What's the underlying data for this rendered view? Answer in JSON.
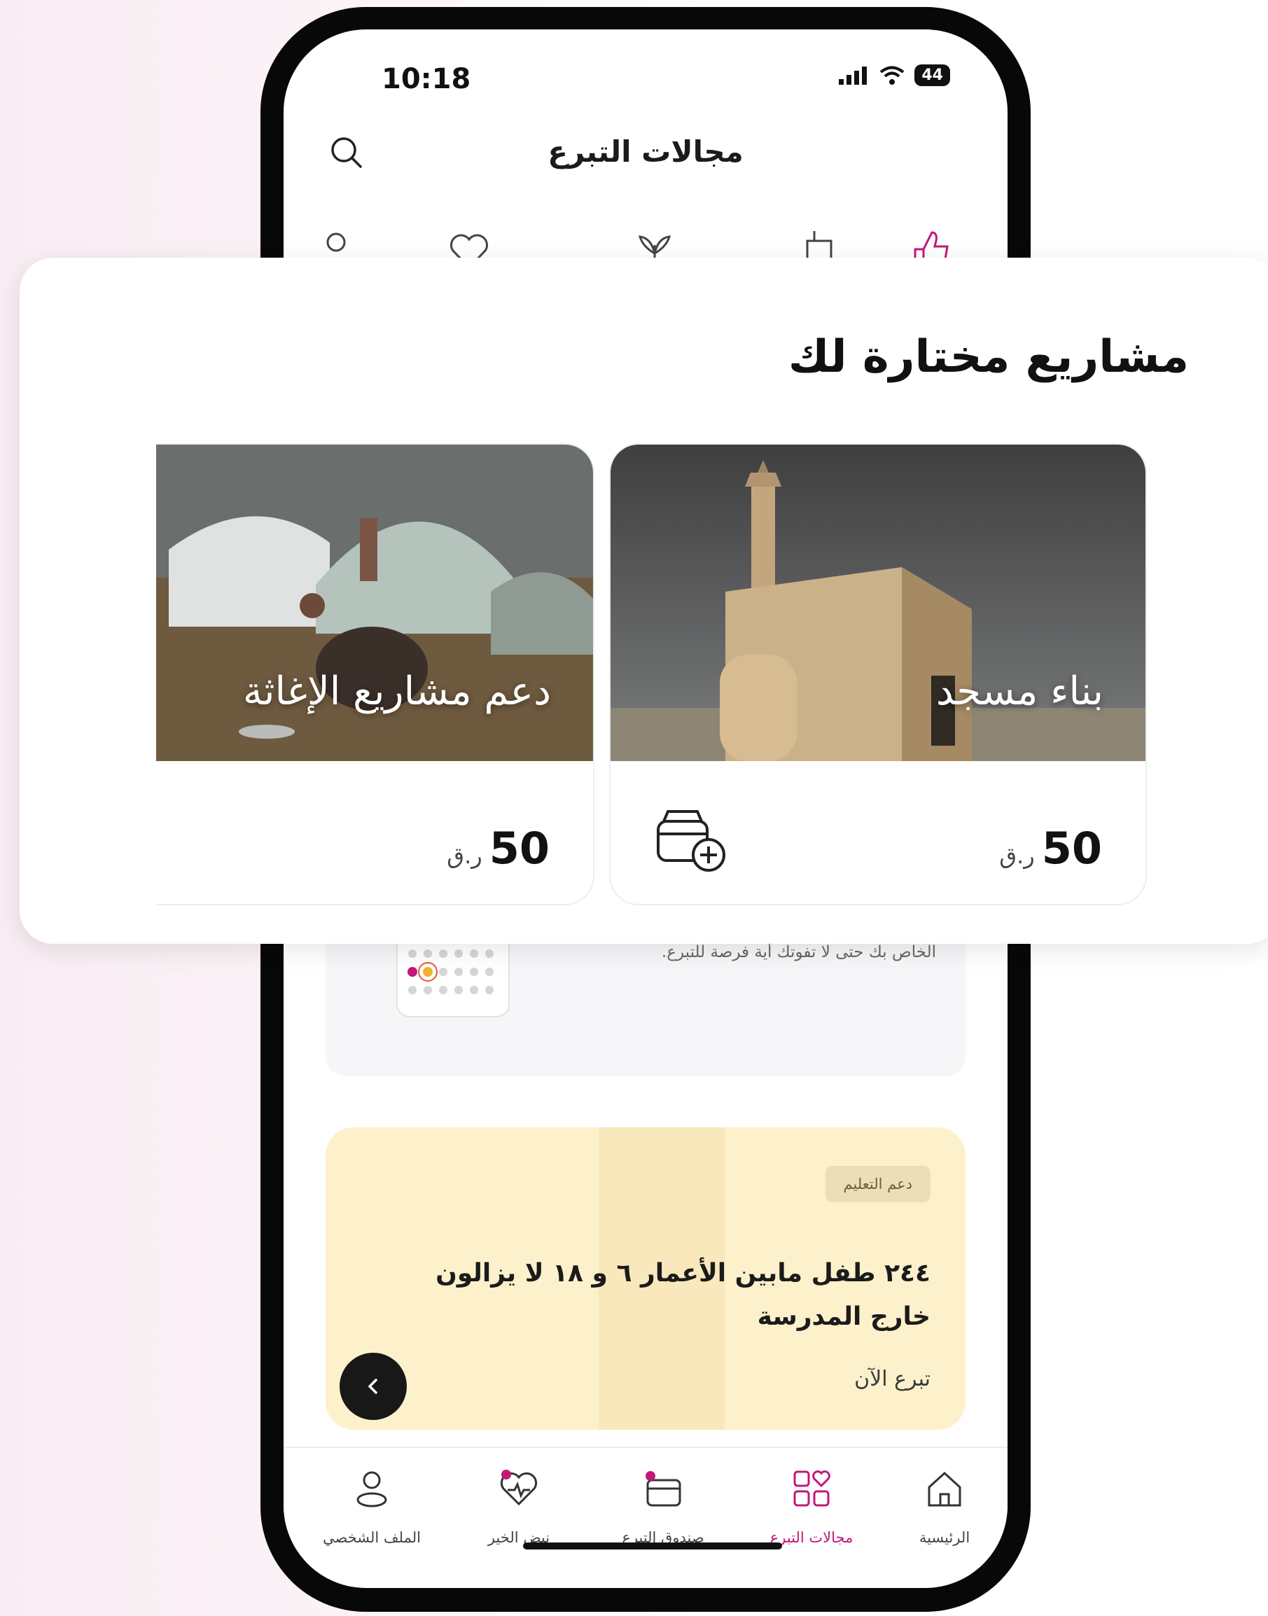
{
  "status": {
    "time": "10:18",
    "battery": "44"
  },
  "header": {
    "title": "مجالات التبرع"
  },
  "featured": {
    "title": "مشاريع مختارة لك",
    "projects": [
      {
        "name": "بناء مسجد",
        "amount": "50",
        "currency": "ر.ق"
      },
      {
        "name": "دعم مشاريع الإغاثة",
        "amount": "50",
        "currency": "ر.ق"
      }
    ]
  },
  "calendar_card": {
    "text": "نقوم بإضافة خطط التبرع للمواسم خلال العام إلى التقويم الخاص بك حتى لا تفوتك أية فرصة للتبرع."
  },
  "banner": {
    "tag": "دعم التعليم",
    "title": "٢٤٤ طفل مابين الأعمار ٦ و ١٨ لا يزالون خارج المدرسة",
    "cta": "تبرع الآن"
  },
  "tabs": [
    {
      "label": "الرئيسية",
      "icon": "home-icon"
    },
    {
      "label": "مجالات التبرع",
      "icon": "categories-icon",
      "active": true
    },
    {
      "label": "صندوق التبرع",
      "icon": "donation-box-icon"
    },
    {
      "label": "نبض الخير",
      "icon": "heart-pulse-icon"
    },
    {
      "label": "الملف الشخصي",
      "icon": "profile-icon"
    }
  ],
  "colors": {
    "accent": "#c2187a",
    "banner_bg": "#fdf1cc"
  }
}
